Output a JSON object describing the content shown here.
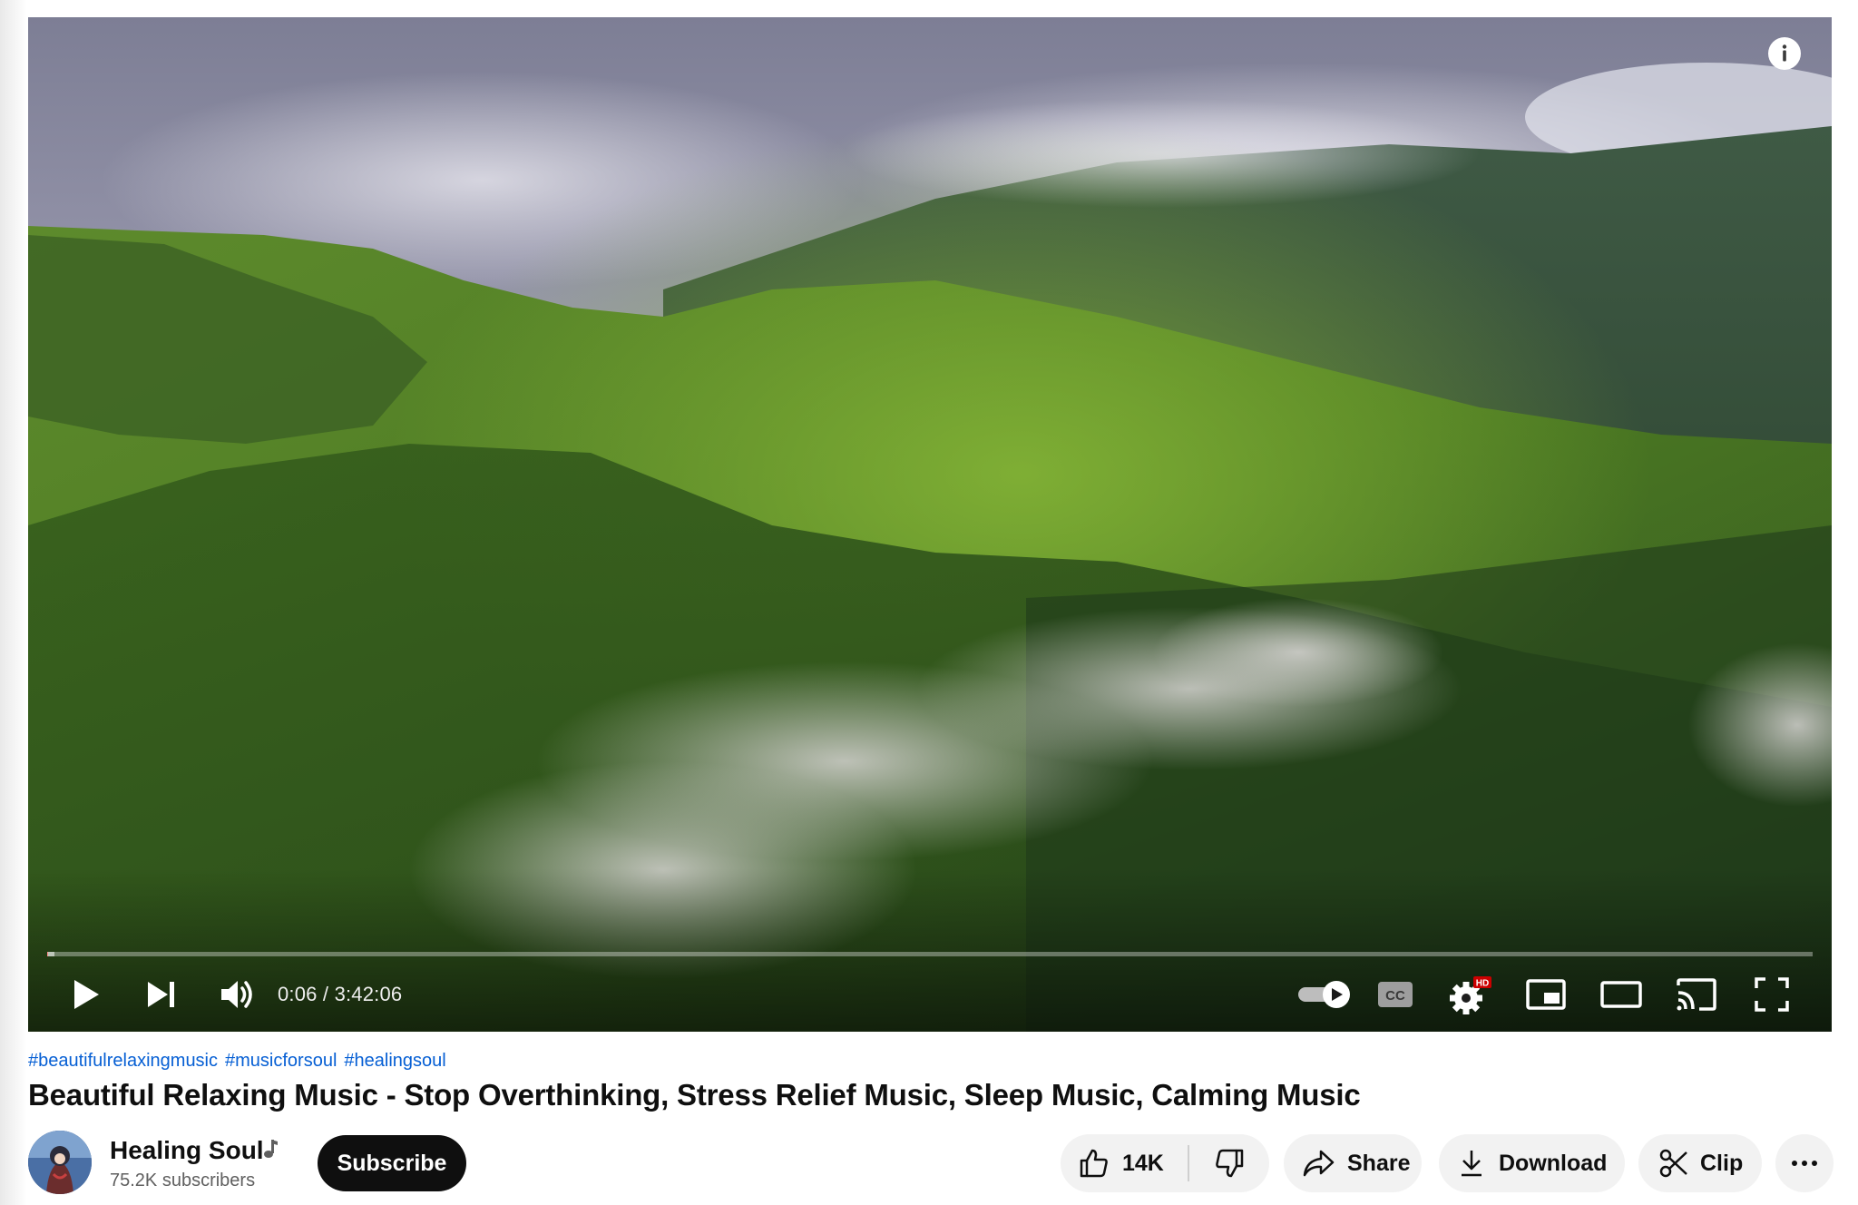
{
  "player": {
    "time_current": "0:06",
    "time_separator": " / ",
    "time_total": "3:42:06",
    "progress_fraction": 0.0005,
    "buffer_fraction": 0.004,
    "hd_badge": "HD",
    "cc_label": "CC",
    "autoplay_on": true
  },
  "video": {
    "hashtags": [
      "#beautifulrelaxingmusic",
      "#musicforsoul",
      "#healingsoul"
    ],
    "title": "Beautiful Relaxing Music - Stop Overthinking, Stress Relief Music, Sleep Music, Calming Music"
  },
  "channel": {
    "name": "Healing Soul",
    "subscribers": "75.2K subscribers",
    "subscribe_label": "Subscribe"
  },
  "actions": {
    "like_count": "14K",
    "share_label": "Share",
    "download_label": "Download",
    "clip_label": "Clip"
  },
  "icons": {
    "play": "play-icon",
    "next": "next-icon",
    "volume": "volume-icon",
    "autoplay": "autoplay-toggle-icon",
    "captions": "captions-icon",
    "settings": "settings-gear-icon",
    "miniplayer": "miniplayer-icon",
    "theater": "theater-mode-icon",
    "cast": "cast-icon",
    "fullscreen": "fullscreen-icon",
    "info": "info-icon",
    "like": "thumbs-up-icon",
    "dislike": "thumbs-down-icon",
    "share": "share-arrow-icon",
    "download": "download-icon",
    "clip": "scissors-icon",
    "more": "more-horizontal-icon",
    "music_note": "music-note-icon"
  },
  "colors": {
    "link_blue": "#065fd4",
    "progress_red": "#ff0000",
    "hd_badge_red": "#cc0000",
    "pill_bg": "#f2f2f2",
    "subscribe_bg": "#0f0f0f"
  }
}
